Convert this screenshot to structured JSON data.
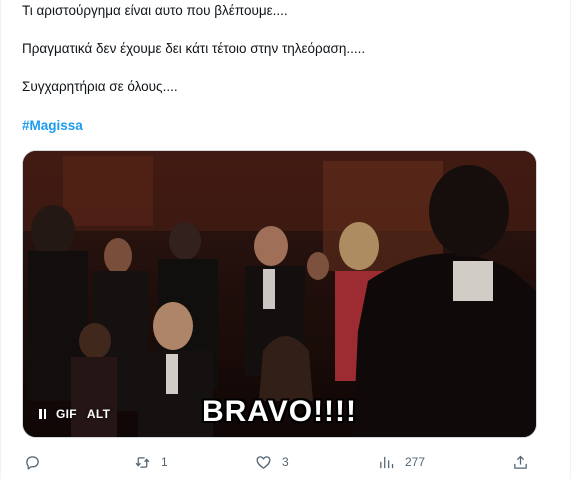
{
  "tweet": {
    "lines": [
      "Τι αριστούργημα είναι αυτο που βλέπουμε....",
      "Πραγματικά δεν έχουμε δει κάτι τέτοιο στην τηλεόραση.....",
      "Συγχαρητήρια σε όλους...."
    ],
    "hashtag": "#Magissa"
  },
  "media": {
    "gif_label": "GIF",
    "alt_label": "ALT",
    "caption": "BRAVO!!!!"
  },
  "actions": {
    "reply_icon": "reply-icon",
    "retweet_icon": "retweet-icon",
    "retweet_count": "1",
    "like_icon": "heart-icon",
    "like_count": "3",
    "views_icon": "views-icon",
    "views_count": "277",
    "share_icon": "share-icon"
  },
  "colors": {
    "accent": "#1d9bf0",
    "muted": "#536471",
    "text": "#0f1419"
  }
}
